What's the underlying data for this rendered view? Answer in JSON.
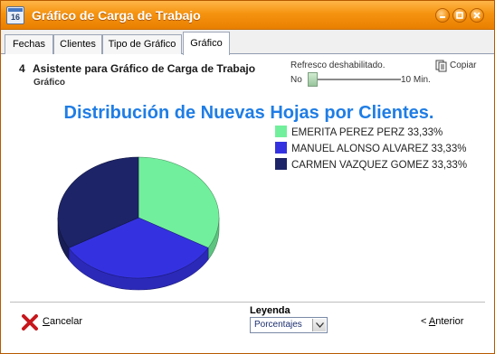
{
  "window": {
    "title": "Gráfico de Carga de Trabajo",
    "icon_label": "16",
    "accent": "#f5930f"
  },
  "tabs": [
    {
      "label": "Fechas",
      "active": false
    },
    {
      "label": "Clientes",
      "active": false
    },
    {
      "label": "Tipo de Gráfico",
      "active": false
    },
    {
      "label": "Gráfico",
      "active": true
    }
  ],
  "wizard": {
    "step_number": "4",
    "step_title": "Asistente para Gráfico de Carga de Trabajo",
    "step_subtitle": "Gráfico"
  },
  "refresh": {
    "label": "Refresco deshabilitado.",
    "min_label": "No",
    "max_label": "10 Min.",
    "level": 0
  },
  "copy": {
    "label": "Copiar",
    "icon": "copy-icon"
  },
  "chart_data": {
    "type": "pie",
    "title": "Distribución de Nuevas Hojas por Clientes.",
    "legend_position": "top-right",
    "slices": [
      {
        "label": "EMERITA PEREZ PERZ 33,33%",
        "value": 33.33,
        "color": "#72ef9c"
      },
      {
        "label": "MANUEL ALONSO ALVAREZ 33,33%",
        "value": 33.33,
        "color": "#3432e0"
      },
      {
        "label": "CARMEN VAZQUEZ GOMEZ 33,33%",
        "value": 33.33,
        "color": "#1d2468"
      }
    ],
    "three_d": true
  },
  "footer": {
    "cancel_label_first": "C",
    "cancel_label_rest": "ancelar",
    "legend_label": "Leyenda",
    "legend_select_value": "Porcentajes",
    "prev_label_prefix": "< ",
    "prev_label_underlined": "A",
    "prev_label_rest": "nterior"
  }
}
